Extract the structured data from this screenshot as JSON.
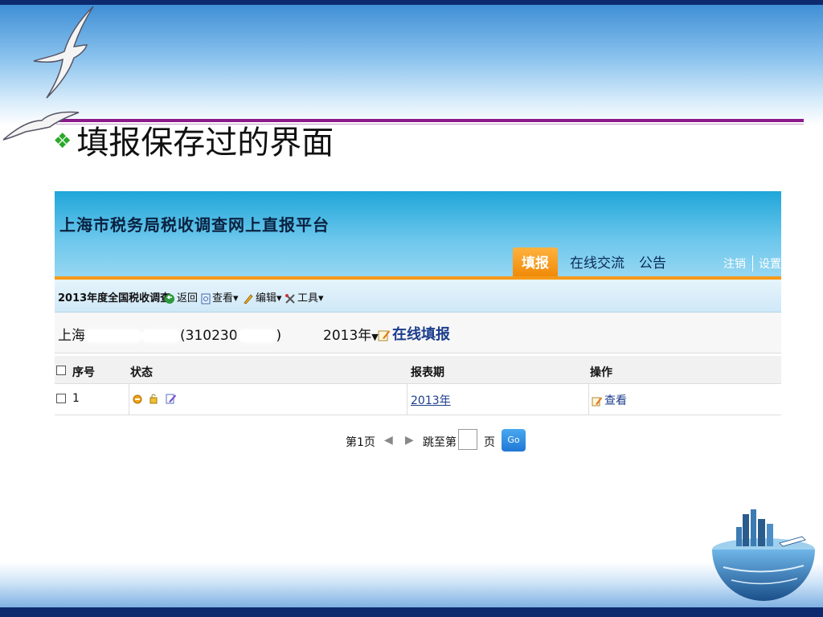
{
  "slide": {
    "title": "填报保存过的界面"
  },
  "app": {
    "title": "上海市税务局税收调查网上直报平台",
    "tabs": [
      {
        "label": "填报",
        "active": true
      },
      {
        "label": "在线交流",
        "active": false
      },
      {
        "label": "公告",
        "active": false
      }
    ],
    "header_links": {
      "logout": "注销",
      "settings": "设置"
    },
    "toolbar": {
      "survey": "2013年度全国税收调查",
      "back": "返回",
      "view": "查看",
      "edit": "编辑",
      "tools": "工具"
    },
    "company": {
      "prefix": "上海",
      "code_start": "(310230",
      "code_end": ")",
      "year": "2013年",
      "online_fill": "在线填报"
    },
    "table": {
      "headers": [
        "序号",
        "状态",
        "报表期",
        "操作"
      ],
      "rows": [
        {
          "no": "1",
          "period": "2013年",
          "action": "查看"
        }
      ]
    },
    "pager": {
      "page_label": "第1页",
      "jump_label": "跳至第",
      "page_suffix": "页",
      "go": "Go"
    }
  },
  "colors": {
    "header_blue": "#1fa6d9",
    "active_tab_orange": "#f59a18",
    "title_rule_purple": "#8b1a8b",
    "link_blue": "#1c3d8c"
  }
}
